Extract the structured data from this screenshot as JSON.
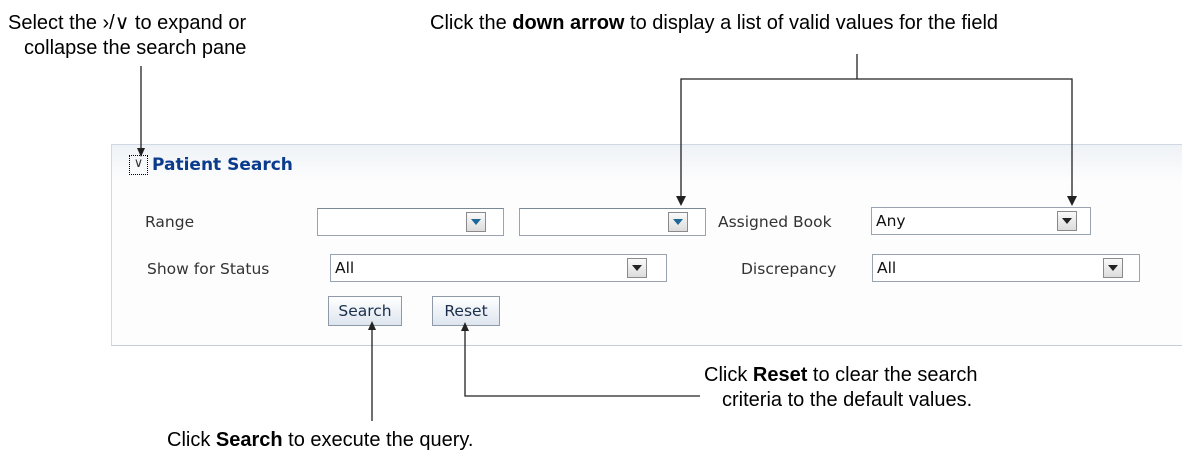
{
  "callouts": {
    "toggle": {
      "line1": "Select the ›/∨ to expand or",
      "line2": "collapse the search pane"
    },
    "arrow": {
      "pre": "Click the ",
      "bold": "down arrow",
      "post": " to display a list of valid values for the field"
    },
    "reset": {
      "pre": "Click ",
      "bold": "Reset",
      "post": " to clear the search",
      "line2": "criteria to the default values."
    },
    "search": {
      "pre": "Click ",
      "bold": "Search",
      "post": " to execute the query."
    }
  },
  "panel": {
    "toggle_glyph": "∨",
    "title": "Patient Search",
    "fields": {
      "range_label": "Range",
      "range_from": "",
      "range_to": "",
      "assigned_book_label": "Assigned Book",
      "assigned_book_value": "Any",
      "show_status_label": "Show for Status",
      "show_status_value": "All",
      "discrepancy_label": "Discrepancy",
      "discrepancy_value": "All"
    },
    "buttons": {
      "search": "Search",
      "reset": "Reset"
    }
  },
  "icons": {
    "toggle": "collapse-chevron-icon",
    "dropdown": "dropdown-arrow-icon"
  },
  "colors": {
    "title": "#0b3b8c",
    "range_arrow": "#1f6797"
  }
}
